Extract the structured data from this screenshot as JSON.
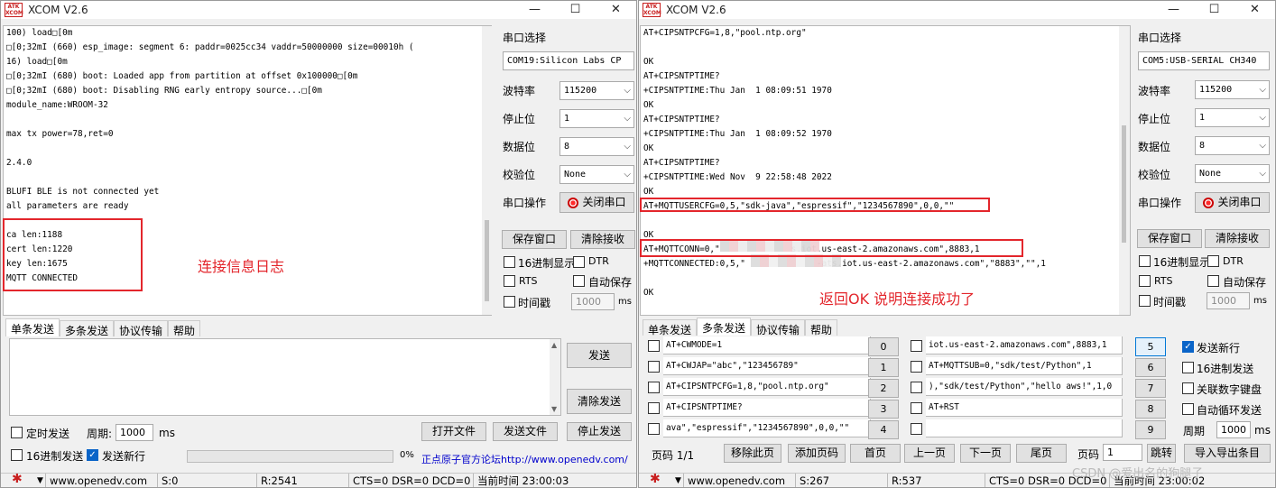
{
  "left": {
    "title": "XCOM V2.6",
    "win_controls": [
      "—",
      "☐",
      "✕"
    ],
    "recv_lines": [
      "100) load□[0m",
      "□[0;32mI (660) esp_image: segment 6: paddr=0025cc34 vaddr=50000000 size=00010h (",
      "16) load□[0m",
      "□[0;32mI (680) boot: Loaded app from partition at offset 0x100000□[0m",
      "□[0;32mI (680) boot: Disabling RNG early entropy source...□[0m",
      "module_name:WROOM-32",
      "",
      "max tx power=78,ret=0",
      "",
      "2.4.0",
      "",
      "BLUFI BLE is not connected yet",
      "all parameters are ready",
      "",
      "ca len:1188",
      "cert len:1220",
      "key len:1675",
      "MQTT CONNECTED"
    ],
    "annotation": "连接信息日志",
    "panel": {
      "port_label": "串口选择",
      "port_value": "COM19:Silicon Labs CP",
      "baud_label": "波特率",
      "baud_value": "115200",
      "stop_label": "停止位",
      "stop_value": "1",
      "data_label": "数据位",
      "data_value": "8",
      "parity_label": "校验位",
      "parity_value": "None",
      "op_label": "串口操作",
      "op_button": "关闭串口",
      "save_window": "保存窗口",
      "clear_recv": "清除接收",
      "hex_display": "16进制显示",
      "dtr": "DTR",
      "rts": "RTS",
      "auto_save": "自动保存",
      "timestamp": "时间戳",
      "timestamp_value": "1000",
      "ms": "ms"
    },
    "tabs": [
      "单条发送",
      "多条发送",
      "协议传输",
      "帮助"
    ],
    "send_button": "发送",
    "clear_send": "清除发送",
    "timed_send": "定时发送",
    "period_label": "周期:",
    "period_value": "1000",
    "ms": "ms",
    "open_file": "打开文件",
    "send_file": "发送文件",
    "stop_send": "停止发送",
    "hex_send": "16进制发送",
    "send_newline": "发送新行",
    "progress_pct": 0,
    "progress_text": "0%",
    "forum_link": "正点原子官方论坛http://www.openedv.com/",
    "status": {
      "site": "www.openedv.com",
      "s": "S:0",
      "r": "R:2541",
      "lines": "CTS=0 DSR=0 DCD=0",
      "time": "当前时间 23:00:03"
    }
  },
  "right": {
    "title": "XCOM V2.6",
    "win_controls": [
      "—",
      "☐",
      "✕"
    ],
    "recv_lines": [
      "AT+CIPSNTPCFG=1,8,\"pool.ntp.org\"",
      "",
      "OK",
      "AT+CIPSNTPTIME?",
      "+CIPSNTPTIME:Thu Jan  1 08:09:51 1970",
      "OK",
      "AT+CIPSNTPTIME?",
      "+CIPSNTPTIME:Thu Jan  1 08:09:52 1970",
      "OK",
      "AT+CIPSNTPTIME?",
      "+CIPSNTPTIME:Wed Nov  9 22:58:48 2022",
      "OK",
      "AT+MQTTUSERCFG=0,5,\"sdk-java\",\"espressif\",\"1234567890\",0,0,\"\"",
      "",
      "OK",
      "AT+MQTTCONN=0,\"              s.iot.us-east-2.amazonaws.com\",8883,1",
      "+MQTTCONNECTED:0,5,\"              -ats.iot.us-east-2.amazonaws.com\",\"8883\",\"\",1",
      "",
      "OK"
    ],
    "annotation": "返回OK 说明连接成功了",
    "panel": {
      "port_label": "串口选择",
      "port_value": "COM5:USB-SERIAL CH340",
      "baud_label": "波特率",
      "baud_value": "115200",
      "stop_label": "停止位",
      "stop_value": "1",
      "data_label": "数据位",
      "data_value": "8",
      "parity_label": "校验位",
      "parity_value": "None",
      "op_label": "串口操作",
      "op_button": "关闭串口",
      "save_window": "保存窗口",
      "clear_recv": "清除接收",
      "hex_display": "16进制显示",
      "dtr": "DTR",
      "rts": "RTS",
      "auto_save": "自动保存",
      "timestamp": "时间戳",
      "timestamp_value": "1000",
      "ms": "ms"
    },
    "tabs": [
      "单条发送",
      "多条发送",
      "协议传输",
      "帮助"
    ],
    "multi_col1": [
      {
        "text": "AT+CWMODE=1",
        "num": "0"
      },
      {
        "text": "AT+CWJAP=\"abc\",\"123456789\"",
        "num": "1"
      },
      {
        "text": "AT+CIPSNTPCFG=1,8,\"pool.ntp.org\"",
        "num": "2"
      },
      {
        "text": "AT+CIPSNTPTIME?",
        "num": "3"
      },
      {
        "text": "ava\",\"espressif\",\"1234567890\",0,0,\"\"",
        "num": "4"
      }
    ],
    "multi_col2": [
      {
        "text": "iot.us-east-2.amazonaws.com\",8883,1",
        "num": "5"
      },
      {
        "text": "AT+MQTTSUB=0,\"sdk/test/Python\",1",
        "num": "6"
      },
      {
        "text": "),\"sdk/test/Python\",\"hello aws!\",1,0",
        "num": "7"
      },
      {
        "text": "AT+RST",
        "num": "8"
      },
      {
        "text": "",
        "num": "9"
      }
    ],
    "opts": {
      "send_newline": "发送新行",
      "hex_send": "16进制发送",
      "link_keyboard": "关联数字键盘",
      "auto_loop": "自动循环发送",
      "period_label": "周期",
      "period_value": "1000",
      "ms": "ms"
    },
    "pager": {
      "page": "页码 1/1",
      "remove": "移除此页",
      "add": "添加页码",
      "first": "首页",
      "prev": "上一页",
      "next": "下一页",
      "last": "尾页",
      "page_label": "页码",
      "page_value": "1",
      "jump": "跳转",
      "import_export": "导入导出条目"
    },
    "status": {
      "site": "www.openedv.com",
      "s": "S:267",
      "r": "R:537",
      "lines": "CTS=0 DSR=0 DCD=0",
      "time": "当前时间 23:00:02"
    }
  },
  "watermark": "CSDN @爱出名的狗腿子",
  "colors": {
    "annot": "#e3262c",
    "link": "#0000cc",
    "logo": "#c81e1e"
  }
}
